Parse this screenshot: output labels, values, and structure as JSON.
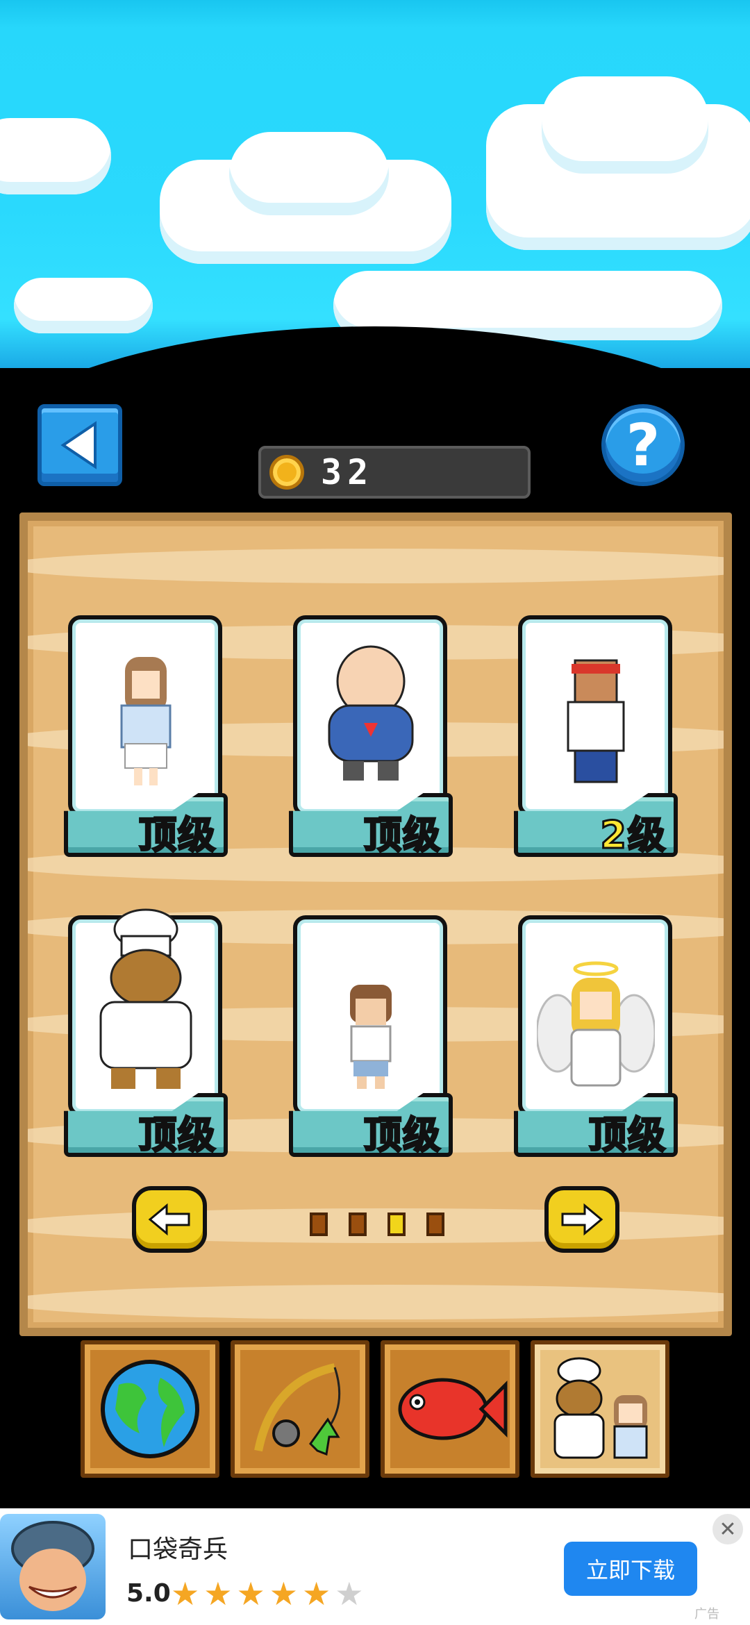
{
  "header": {
    "back_icon": "triangle-left-icon",
    "help_label": "?",
    "coins": "32"
  },
  "characters": [
    {
      "name": "girl",
      "level": "顶级"
    },
    {
      "name": "big-man",
      "level": "顶级"
    },
    {
      "name": "bandana-man",
      "level": "2级"
    },
    {
      "name": "bear-chef",
      "level": "顶级"
    },
    {
      "name": "boy",
      "level": "顶级"
    },
    {
      "name": "angel",
      "level": "顶级"
    }
  ],
  "pager": {
    "page_count": 4,
    "active_page": 3
  },
  "tabs": [
    {
      "name": "world",
      "icon": "globe-icon",
      "active": false
    },
    {
      "name": "rod",
      "icon": "fishing-rod-icon",
      "active": false
    },
    {
      "name": "fish",
      "icon": "red-fish-icon",
      "active": false
    },
    {
      "name": "characters",
      "icon": "characters-icon",
      "active": true
    }
  ],
  "ad": {
    "title": "口袋奇兵",
    "rating": "5.0",
    "stars_on": "★★★★★",
    "stars_off": "★",
    "cta": "立即下载",
    "close": "✕",
    "tag": "广告"
  },
  "colors": {
    "sky": "#2ad9fd",
    "sand": "#e7ba7a",
    "button_blue": "#2a9de8",
    "level_yellow": "#ffe733",
    "card_teal": "#6cc7c6",
    "cta_blue": "#1f87f0"
  }
}
